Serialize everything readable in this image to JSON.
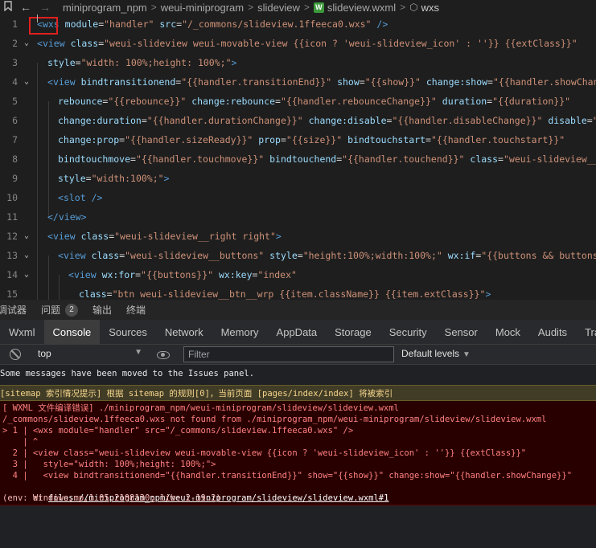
{
  "breadcrumb": {
    "items": [
      "miniprogram_npm",
      "weui-miniprogram",
      "slideview",
      "slideview.wxml",
      "wxs"
    ],
    "file_icon_letter": "W"
  },
  "editor": {
    "lines": [
      {
        "n": "1",
        "fold": "",
        "indent": 0
      },
      {
        "n": "2",
        "fold": "⌄",
        "indent": 0
      },
      {
        "n": "3",
        "fold": "",
        "indent": 1
      },
      {
        "n": "4",
        "fold": "⌄",
        "indent": 1
      },
      {
        "n": "5",
        "fold": "",
        "indent": 2
      },
      {
        "n": "6",
        "fold": "",
        "indent": 2
      },
      {
        "n": "7",
        "fold": "",
        "indent": 2
      },
      {
        "n": "8",
        "fold": "",
        "indent": 2
      },
      {
        "n": "9",
        "fold": "",
        "indent": 2
      },
      {
        "n": "10",
        "fold": "",
        "indent": 2
      },
      {
        "n": "11",
        "fold": "",
        "indent": 1
      },
      {
        "n": "12",
        "fold": "⌄",
        "indent": 1
      },
      {
        "n": "13",
        "fold": "⌄",
        "indent": 2
      },
      {
        "n": "14",
        "fold": "⌄",
        "indent": 3
      },
      {
        "n": "15",
        "fold": "",
        "indent": 4
      }
    ],
    "tokens": {
      "l1": [
        "<",
        "wxs",
        " module",
        "=",
        "\"handler\"",
        " src",
        "=",
        "\"/_commons/slideview.1ffeeca0.wxs\"",
        " />"
      ],
      "l2": [
        "<",
        "view",
        " class",
        "=",
        "\"weui-slideview weui-movable-view {{icon ? 'weui-slideview_icon' : ''}} {{extClass}}\""
      ],
      "l3": [
        "style",
        "=",
        "\"width: 100%;height: 100%;\"",
        ">"
      ],
      "l4": [
        "<",
        "view",
        " bindtransitionend",
        "=",
        "\"{{handler.transitionEnd}}\"",
        " show",
        "=",
        "\"{{show}}\"",
        " change:show",
        "=",
        "\"{{handler.showChange}}\""
      ],
      "l5": [
        "rebounce",
        "=",
        "\"{{rebounce}}\"",
        " change:rebounce",
        "=",
        "\"{{handler.rebounceChange}}\"",
        " duration",
        "=",
        "\"{{duration}}\""
      ],
      "l6": [
        "change:duration",
        "=",
        "\"{{handler.durationChange}}\"",
        " change:disable",
        "=",
        "\"{{handler.disableChange}}\"",
        " disable",
        "=",
        "\"{{disable}}\""
      ],
      "l7": [
        "change:prop",
        "=",
        "\"{{handler.sizeReady}}\"",
        " prop",
        "=",
        "\"{{size}}\"",
        " bindtouchstart",
        "=",
        "\"{{handler.touchstart}}\""
      ],
      "l8": [
        "bindtouchmove",
        "=",
        "\"{{handler.touchmove}}\"",
        " bindtouchend",
        "=",
        "\"{{handler.touchend}}\"",
        " class",
        "=",
        "\"weui-slideview__left left\""
      ],
      "l9": [
        "style",
        "=",
        "\"width:100%;\"",
        ">"
      ],
      "l10": [
        "<",
        "slot",
        " />"
      ],
      "l11": [
        "</",
        "view",
        ">"
      ],
      "l12": [
        "<",
        "view",
        " class",
        "=",
        "\"weui-slideview__right right\"",
        ">"
      ],
      "l13": [
        "<",
        "view",
        " class",
        "=",
        "\"weui-slideview__buttons\"",
        " style",
        "=",
        "\"height:100%;width:100%;\"",
        " wx:if",
        "=",
        "\"{{buttons && buttons.length}}\""
      ],
      "l14": [
        "<",
        "view",
        " wx:for",
        "=",
        "\"{{buttons}}\"",
        " wx:key",
        "=",
        "\"index\""
      ],
      "l15": [
        "class",
        "=",
        "\"btn weui-slideview__btn__wrp {{item.className}} {{item.extClass}}\"",
        ">"
      ]
    }
  },
  "panel_tabs": [
    {
      "label": "调试器"
    },
    {
      "label": "问题",
      "badge": "2"
    },
    {
      "label": "输出"
    },
    {
      "label": "终端"
    }
  ],
  "devtools_tabs": [
    "Wxml",
    "Console",
    "Sources",
    "Network",
    "Memory",
    "AppData",
    "Storage",
    "Security",
    "Sensor",
    "Mock",
    "Audits",
    "Trace"
  ],
  "active_devtools_tab": "Console",
  "console_toolbar": {
    "context": "top",
    "filter_placeholder": "Filter",
    "levels": "Default levels"
  },
  "console": {
    "info": "Some messages have been moved to the Issues panel.",
    "warning": "[sitemap 索引情况提示] 根据 sitemap 的规则[0]，当前页面 [pages/index/index] 将被索引",
    "error_lines": [
      "[ WXML 文件编译错误] ./miniprogram_npm/weui-miniprogram/slideview/slideview.wxml",
      "/_commons/slideview.1ffeeca0.wxs not found from ./miniprogram_npm/weui-miniprogram/slideview/slideview.wxml",
      "> 1 | <wxs module=\"handler\" src=\"/_commons/slideview.1ffeeca0.wxs\" />",
      "    | ^",
      "  2 | <view class=\"weui-slideview weui-movable-view {{icon ? 'weui-slideview_icon' : ''}} {{extClass}}\"",
      "  3 |   style=\"width: 100%;height: 100%;\">",
      "  4 |   <view bindtransitionend=\"{{handler.transitionEnd}}\" show=\"{{show}}\" change:show=\"{{handler.showChange}}\""
    ],
    "at_prefix": "at ",
    "at_link": "files://miniprogram_npm/weui-miniprogram/slideview/slideview.wxml#1",
    "env": "(env: Windows,mp,1.05.2108130; lib: 2.19.2)"
  }
}
